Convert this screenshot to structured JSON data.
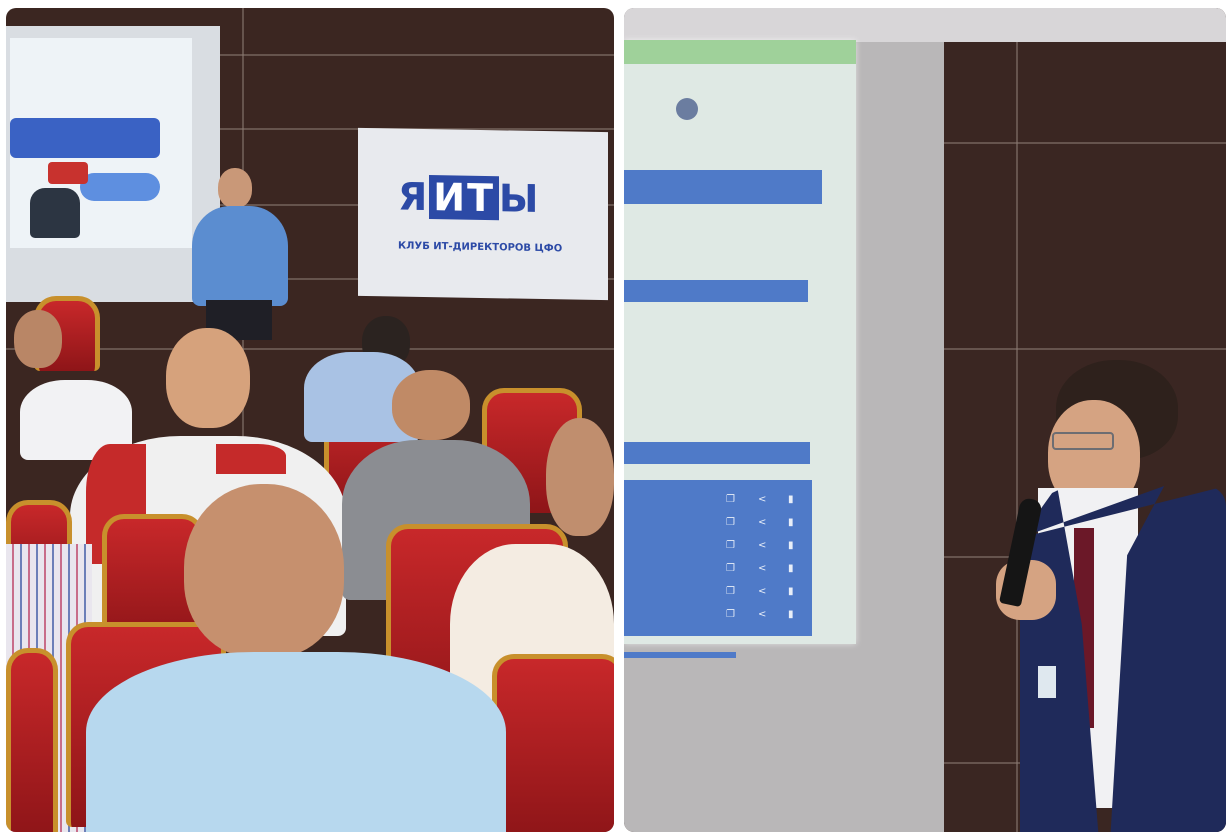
{
  "left_photo": {
    "banner": {
      "logo_prefix": "Я",
      "logo_box": "ИТ",
      "logo_suffix": "Ы",
      "subtitle": "КЛУБ ИТ-ДИРЕКТОРОВ ЦФО"
    },
    "colors": {
      "banner_blue": "#2c4aa6",
      "chair_red": "#b01e22",
      "chair_frame": "#c8902c",
      "wall_brown": "#3b2621"
    }
  },
  "right_photo": {
    "colors": {
      "screen_blue": "#4f7ac8",
      "wall_brown": "#3a2622",
      "suit_navy": "#1f2a5a"
    },
    "icons": [
      "copy-icon",
      "share-icon",
      "delete-icon"
    ]
  }
}
